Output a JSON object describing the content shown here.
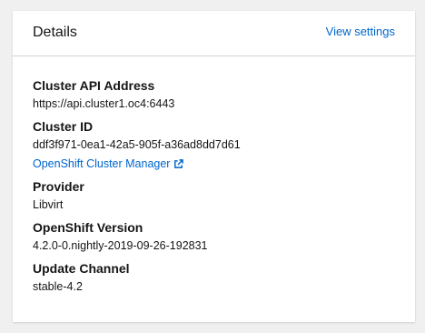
{
  "card": {
    "title": "Details",
    "view_settings_label": "View settings"
  },
  "details": [
    {
      "term": "Cluster API Address",
      "value": "https://api.cluster1.oc4:6443"
    },
    {
      "term": "Cluster ID",
      "value": "ddf3f971-0ea1-42a5-905f-a36ad8dd7d61",
      "link_label": "OpenShift Cluster Manager",
      "link_icon": "external-link-icon"
    },
    {
      "term": "Provider",
      "value": "Libvirt"
    },
    {
      "term": "OpenShift Version",
      "value": "4.2.0-0.nightly-2019-09-26-192831"
    },
    {
      "term": "Update Channel",
      "value": "stable-4.2"
    }
  ],
  "colors": {
    "link": "#0066cc",
    "text": "#151515",
    "background": "#f0f0f0",
    "card": "#ffffff",
    "divider": "#d2d2d2"
  }
}
